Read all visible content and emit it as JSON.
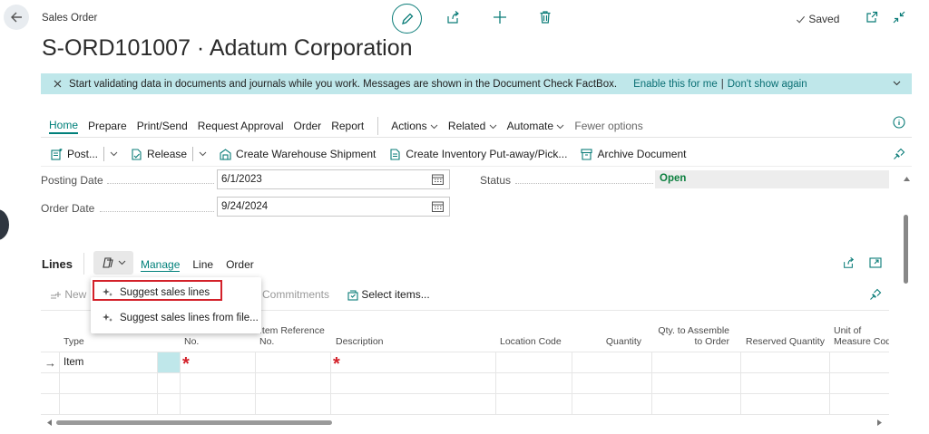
{
  "header": {
    "doc_type": "Sales Order",
    "title": "S-ORD101007 · Adatum Corporation",
    "saved_label": "Saved"
  },
  "banner": {
    "message": "Start validating data in documents and journals while you work. Messages are shown in the Document Check FactBox.",
    "enable_link": "Enable this for me",
    "separator": "|",
    "dismiss_link": "Don't show again"
  },
  "action_menu": {
    "items": [
      "Home",
      "Prepare",
      "Print/Send",
      "Request Approval",
      "Order",
      "Report"
    ],
    "dropdowns": [
      "Actions",
      "Related",
      "Automate"
    ],
    "fewer_options": "Fewer options"
  },
  "toolbar": {
    "post": "Post...",
    "release": "Release",
    "create_shipment": "Create Warehouse Shipment",
    "create_putaway": "Create Inventory Put-away/Pick...",
    "archive": "Archive Document"
  },
  "fields": {
    "posting_date_label": "Posting Date",
    "posting_date_value": "6/1/2023",
    "order_date_label": "Order Date",
    "order_date_value": "9/24/2024",
    "status_label": "Status",
    "status_value": "Open"
  },
  "lines": {
    "title": "Lines",
    "menu": [
      "Manage",
      "Line",
      "Order"
    ],
    "toolbar_new": "New",
    "toolbar_commitments": "Commitments",
    "toolbar_select_items": "Select items...",
    "popup": {
      "suggest": "Suggest sales lines",
      "suggest_file": "Suggest sales lines from file..."
    },
    "columns": {
      "type": "Type",
      "no": "No.",
      "item_ref_1": "Item Reference",
      "item_ref_2": "No.",
      "description": "Description",
      "location": "Location Code",
      "quantity": "Quantity",
      "qty_assemble_1": "Qty. to Assemble",
      "qty_assemble_2": "to Order",
      "reserved": "Reserved Quantity",
      "uom_1": "Unit of",
      "uom_2": "Measure Code"
    },
    "rows": [
      {
        "indicator": "→",
        "type": "Item",
        "no_required": "*",
        "description_required": "*"
      }
    ]
  },
  "colors": {
    "accent": "#00807a",
    "banner_bg": "#bfe7ea",
    "status_open": "#0b7f3e",
    "highlight": "#d3212a"
  }
}
